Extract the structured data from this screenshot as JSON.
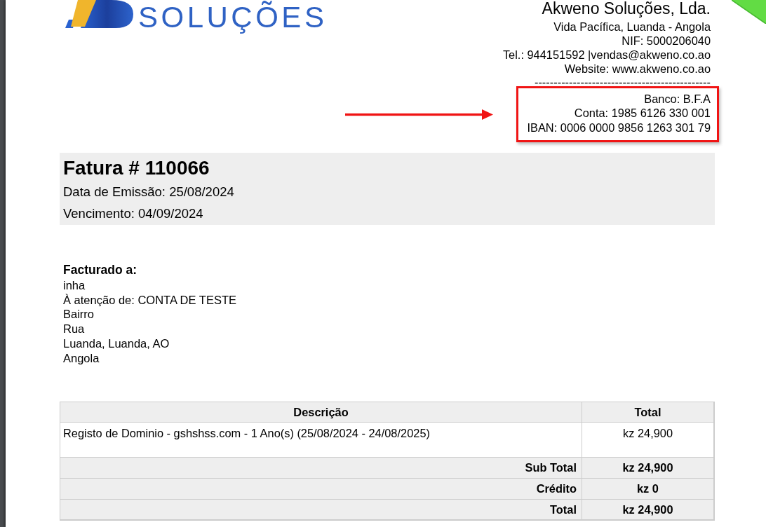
{
  "logo": {
    "text": "SOLUÇÕES"
  },
  "company": {
    "name": "Akweno Soluções, Lda.",
    "lines": [
      "Vida Pacífica, Luanda - Angola",
      "NIF: 5000206040",
      "Tel.: 944151592 |vendas@akweno.co.ao",
      "Website: www.akweno.co.ao"
    ],
    "separator": "----------------------------------------------"
  },
  "bank": {
    "lines": [
      "Banco: B.F.A",
      "Conta: 1985 6126 330 001",
      "IBAN: 0006 0000 9856 1263 301 79"
    ]
  },
  "invoice": {
    "title": "Fatura # 110066",
    "issue_date": "Data de Emissão: 25/08/2024",
    "due_date": "Vencimento: 04/09/2024"
  },
  "billed_to": {
    "heading": "Facturado a:",
    "lines": [
      "inha",
      "À atenção de: CONTA DE TESTE",
      "Bairro",
      "Rua",
      "Luanda, Luanda, AO",
      "Angola"
    ]
  },
  "table": {
    "columns": [
      "Descrição",
      "Total"
    ],
    "rows": [
      {
        "description": "Registo de Dominio - gshshss.com - 1 Ano(s) (25/08/2024 - 24/08/2025)",
        "total": "kz 24,900"
      }
    ],
    "summary": [
      {
        "label": "Sub Total",
        "value": "kz 24,900"
      },
      {
        "label": "Crédito",
        "value": "kz 0"
      },
      {
        "label": "Total",
        "value": "kz 24,900"
      }
    ]
  }
}
